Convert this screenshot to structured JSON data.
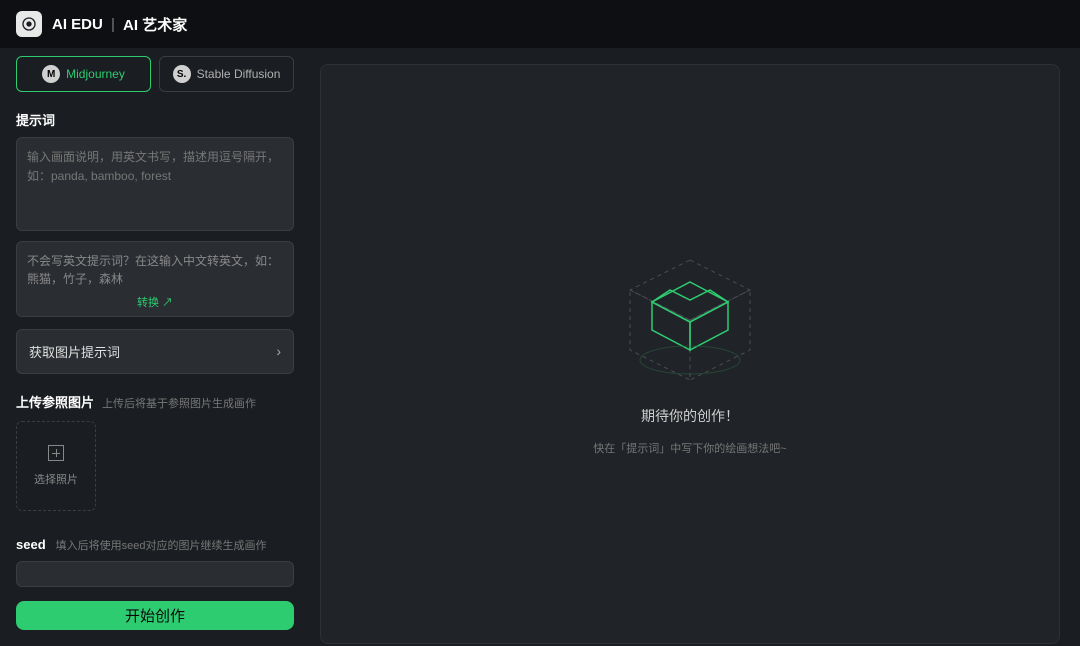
{
  "header": {
    "brand": "AI EDU",
    "subtitle": "AI 艺术家"
  },
  "models": {
    "midjourney": "Midjourney",
    "stable_diffusion": "Stable Diffusion"
  },
  "prompt": {
    "label": "提示词",
    "placeholder": "输入画面说明，用英文书写，描述用逗号隔开，如：panda, bamboo, forest"
  },
  "translate": {
    "placeholder": "不会写英文提示词？在这输入中文转英文，如：熊猫，竹子，森林",
    "button": "转换 ↗"
  },
  "get_prompt": {
    "label": "获取图片提示词"
  },
  "upload": {
    "label": "上传参照图片",
    "hint": "上传后将基于参照图片生成画作",
    "button": "选择照片"
  },
  "seed": {
    "label": "seed",
    "hint": "填入后将使用seed对应的图片继续生成画作"
  },
  "generate": {
    "label": "开始创作"
  },
  "canvas": {
    "title": "期待你的创作！",
    "hint": "快在「提示词」中写下你的绘画想法吧~"
  }
}
